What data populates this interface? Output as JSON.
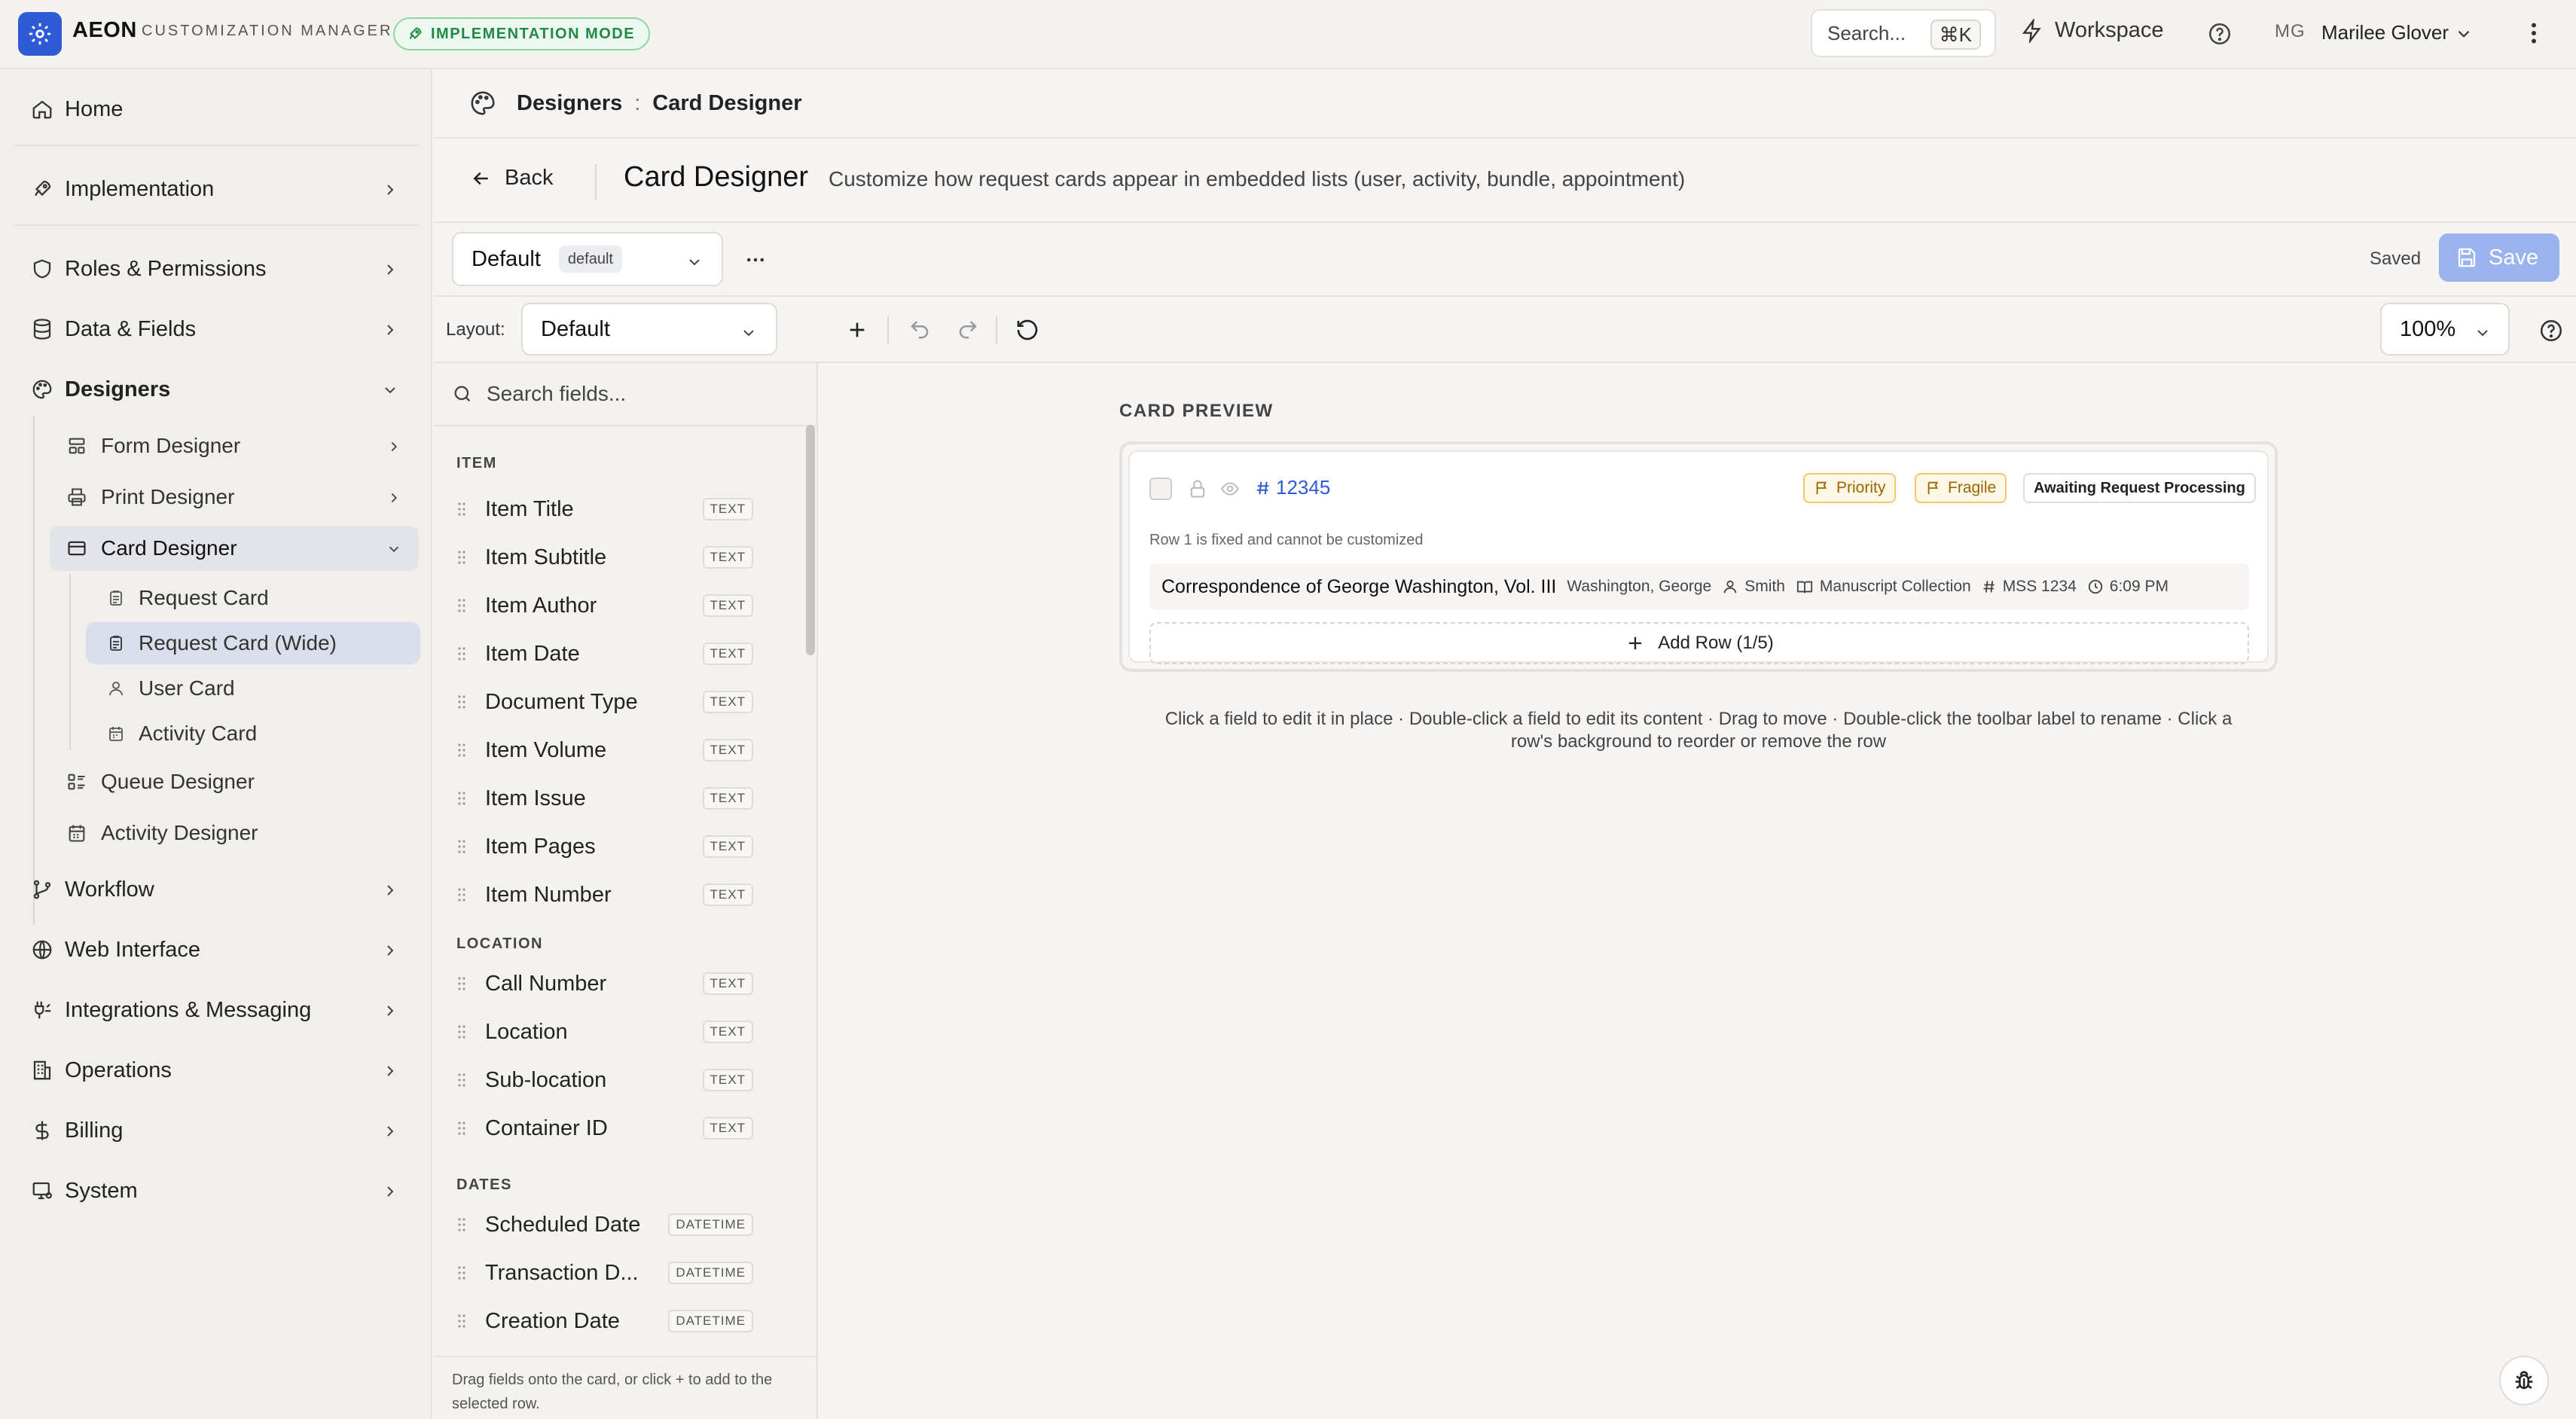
{
  "app": {
    "brand": "AEON",
    "subtitle": "CUSTOMIZATION MANAGER",
    "mode_badge": "IMPLEMENTATION MODE",
    "accent_color": "#2f5bd6"
  },
  "topbar": {
    "search_label": "Search...",
    "search_shortcut": "⌘K",
    "workspace_label": "Workspace",
    "user_initials": "MG",
    "user_name": "Marilee Glover"
  },
  "sidebar": {
    "home": "Home",
    "implementation": "Implementation",
    "roles": "Roles & Permissions",
    "data_fields": "Data & Fields",
    "designers": "Designers",
    "designers_children": {
      "form": "Form Designer",
      "print": "Print Designer",
      "card": "Card Designer",
      "card_children": {
        "request_card": "Request Card",
        "request_card_wide": "Request Card (Wide)",
        "user_card": "User Card",
        "activity_card": "Activity Card"
      },
      "queue": "Queue Designer",
      "activity": "Activity Designer"
    },
    "workflow": "Workflow",
    "web_interface": "Web Interface",
    "integrations": "Integrations & Messaging",
    "operations": "Operations",
    "billing": "Billing",
    "system": "System"
  },
  "breadcrumb": {
    "parent": "Designers",
    "separator": ":",
    "current": "Card Designer"
  },
  "header": {
    "back_label": "Back",
    "title": "Card Designer",
    "description": "Customize how request cards appear in embedded lists (user, activity, bundle, appointment)"
  },
  "toolbar": {
    "preset_name": "Default",
    "preset_tag": "default",
    "saved_status": "Saved",
    "save_label": "Save",
    "layout_label": "Layout:",
    "layout_value": "Default",
    "zoom_value": "100%"
  },
  "palette": {
    "search_placeholder": "Search fields...",
    "groups": {
      "item": "ITEM",
      "location": "LOCATION",
      "dates": "DATES"
    },
    "item_fields": [
      {
        "label": "Item Title",
        "type": "TEXT"
      },
      {
        "label": "Item Subtitle",
        "type": "TEXT"
      },
      {
        "label": "Item Author",
        "type": "TEXT"
      },
      {
        "label": "Item Date",
        "type": "TEXT"
      },
      {
        "label": "Document Type",
        "type": "TEXT"
      },
      {
        "label": "Item Volume",
        "type": "TEXT"
      },
      {
        "label": "Item Issue",
        "type": "TEXT"
      },
      {
        "label": "Item Pages",
        "type": "TEXT"
      },
      {
        "label": "Item Number",
        "type": "TEXT"
      }
    ],
    "location_fields": [
      {
        "label": "Call Number",
        "type": "TEXT"
      },
      {
        "label": "Location",
        "type": "TEXT"
      },
      {
        "label": "Sub-location",
        "type": "TEXT"
      },
      {
        "label": "Container ID",
        "type": "TEXT"
      }
    ],
    "date_fields": [
      {
        "label": "Scheduled Date",
        "type": "DATETIME"
      },
      {
        "label": "Transaction D...",
        "type": "DATETIME"
      },
      {
        "label": "Creation Date",
        "type": "DATETIME"
      }
    ],
    "footer_hint": "Drag fields onto the card, or click + to add to the selected row."
  },
  "preview": {
    "label": "CARD PREVIEW",
    "request_number": "12345",
    "badges": {
      "priority": "Priority",
      "fragile": "Fragile",
      "status": "Awaiting Request Processing"
    },
    "row1_note": "Row 1 is fixed and cannot be customized",
    "row2": {
      "title": "Correspondence of George Washington, Vol. III",
      "author": "Washington, George",
      "user": "Smith",
      "collection": "Manuscript Collection",
      "call_number": "MSS 1234",
      "time": "6:09 PM"
    },
    "add_row_label": "Add Row (1/5)",
    "hint_line1": "Click a field to edit it in place · Double-click a field to edit its content · Drag to move · Double-click the toolbar label to rename · Click a",
    "hint_line2": "row's background to reorder or remove the row"
  }
}
